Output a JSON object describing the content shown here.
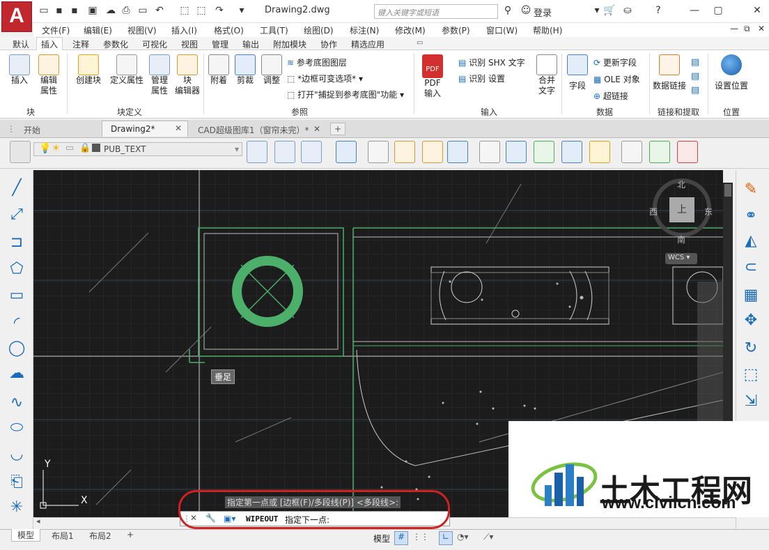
{
  "app": {
    "logo_letter": "A",
    "document_title": "Drawing2.dwg",
    "search_placeholder": "键入关键字或短语",
    "login_label": "登录"
  },
  "menubar": [
    "文件(F)",
    "编辑(E)",
    "视图(V)",
    "插入(I)",
    "格式(O)",
    "工具(T)",
    "绘图(D)",
    "标注(N)",
    "修改(M)",
    "参数(P)",
    "窗口(W)",
    "帮助(H)"
  ],
  "ribbon_tabs": [
    "默认",
    "插入",
    "注释",
    "参数化",
    "可视化",
    "视图",
    "管理",
    "输出",
    "附加模块",
    "协作",
    "精选应用"
  ],
  "ribbon_active_tab": "插入",
  "ribbon": {
    "block": {
      "insert": "插入",
      "edit_attr_1": "编辑",
      "edit_attr_2": "属性",
      "group": "块"
    },
    "block_def": {
      "create": "创建块",
      "define_attr": "定义属性",
      "manage_1": "管理",
      "manage_2": "属性",
      "editor_1": "块",
      "editor_2": "编辑器",
      "group": "块定义"
    },
    "reference": {
      "attach": "附着",
      "clip": "剪裁",
      "adjust": "调整",
      "underlay_layers": "参考底图图层",
      "frame_var": "*边框可变选项*",
      "snap_underlay": "打开\"捕捉到参考底图\"功能",
      "group": "参照"
    },
    "import": {
      "pdf_icon": "PDF",
      "pdf_1": "PDF",
      "pdf_2": "输入",
      "recognize_shx": "识别 SHX 文字",
      "recognize_settings": "识别 设置",
      "merge_1": "合并",
      "merge_2": "文字",
      "group": "输入"
    },
    "data": {
      "field": "字段",
      "update_fields": "更新字段",
      "ole": "OLE 对象",
      "hyperlink": "超链接",
      "group": "数据"
    },
    "link_extract": {
      "data_link": "数据链接",
      "group": "链接和提取"
    },
    "location": {
      "set_location": "设置位置",
      "group": "位置"
    }
  },
  "doc_tabs": [
    "开始",
    "Drawing2*",
    "CAD超级图库1（窗帘未完）*"
  ],
  "layer_combo": "PUB_TEXT",
  "viewcube": {
    "north": "北",
    "south": "南",
    "east": "东",
    "west": "西",
    "top": "上",
    "wcs": "WCS"
  },
  "tooltip": "垂足",
  "ucs": {
    "y": "Y",
    "x": "X"
  },
  "command": {
    "history": "指定第一点或 [边框(F)/多段线(P)] <多段线>:",
    "prompt_cmd": "WIPEOUT",
    "prompt_text": "指定下一点:"
  },
  "layout_tabs": [
    "模型",
    "布局1",
    "布局2"
  ],
  "status": {
    "model_label": "模型"
  },
  "watermark": {
    "title": "土木工程网",
    "url": "www.civilcn.com"
  },
  "colors": {
    "accent": "#c1272d",
    "canvas_bg": "#1c1c1c",
    "highlight_green": "#4caf6a",
    "annotation_red": "#d02020"
  }
}
